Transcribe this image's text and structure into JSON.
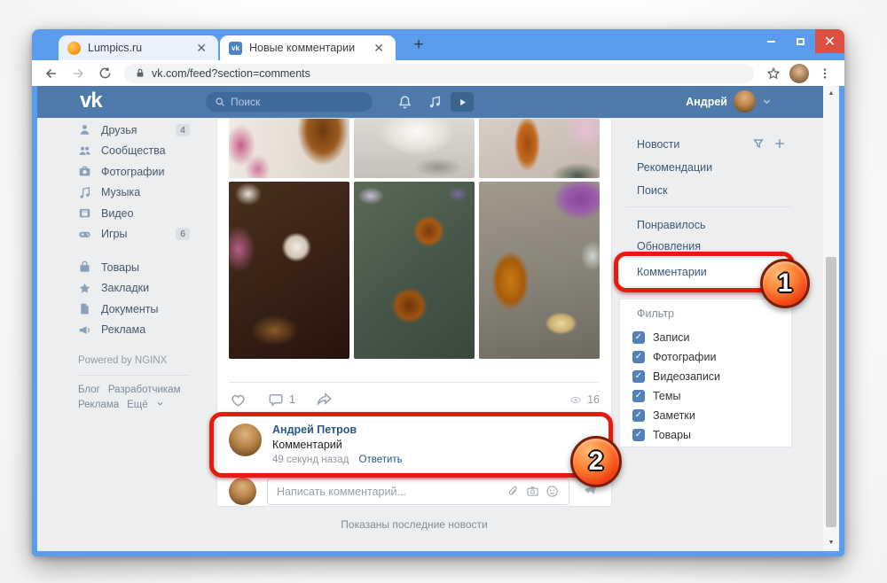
{
  "browser": {
    "tabs": [
      {
        "title": "Lumpics.ru"
      },
      {
        "title": "Новые комментарии"
      }
    ],
    "url": "vk.com/feed?section=comments"
  },
  "header": {
    "logo": "vk",
    "search_placeholder": "Поиск",
    "user_name": "Андрей"
  },
  "sidebar": {
    "items": [
      {
        "label": "Друзья",
        "badge": "4",
        "icon": "friend-icon"
      },
      {
        "label": "Сообщества",
        "icon": "communities-icon"
      },
      {
        "label": "Фотографии",
        "icon": "photos-icon"
      },
      {
        "label": "Музыка",
        "icon": "music-icon"
      },
      {
        "label": "Видео",
        "icon": "video-icon"
      },
      {
        "label": "Игры",
        "badge": "6",
        "icon": "games-icon"
      },
      {
        "label": "Товары",
        "icon": "market-icon"
      },
      {
        "label": "Закладки",
        "icon": "bookmarks-icon"
      },
      {
        "label": "Документы",
        "icon": "documents-icon"
      },
      {
        "label": "Реклама",
        "icon": "ads-icon"
      }
    ],
    "powered": "Powered by NGINX",
    "footer_links": [
      "Блог",
      "Разработчикам",
      "Реклама",
      "Ещё"
    ]
  },
  "post": {
    "comments_count": "1",
    "views_count": "16",
    "comment": {
      "author": "Андрей Петров",
      "text": "Комментарий",
      "time": "49 секунд назад",
      "reply_label": "Ответить"
    },
    "comment_placeholder": "Написать комментарий..."
  },
  "feed_end_text": "Показаны последние новости",
  "right_menu": {
    "items": [
      "Новости",
      "Рекомендации",
      "Поиск",
      "Понравилось",
      "Обновления",
      "Комментарии"
    ],
    "selected": "Комментарии"
  },
  "filter": {
    "title": "Фильтр",
    "options": [
      {
        "label": "Записи",
        "checked": true
      },
      {
        "label": "Фотографии",
        "checked": true
      },
      {
        "label": "Видеозаписи",
        "checked": true
      },
      {
        "label": "Темы",
        "checked": true
      },
      {
        "label": "Заметки",
        "checked": true
      },
      {
        "label": "Товары",
        "checked": true
      }
    ]
  },
  "annotations": {
    "step1": "1",
    "step2": "2"
  },
  "colors": {
    "vk_header": "#4d79ab",
    "chrome_frame": "#5b9ded",
    "annotation_red": "#e41c10",
    "link_blue": "#2a5885",
    "checkbox_blue": "#5181b8"
  }
}
